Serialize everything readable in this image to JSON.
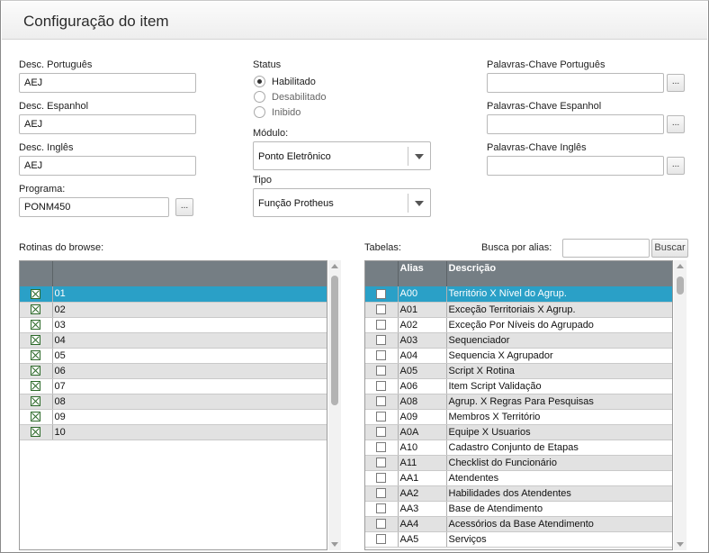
{
  "window": {
    "title": "Configuração do item"
  },
  "desc": {
    "portugues_label": "Desc. Português",
    "portugues_value": "AEJ",
    "espanhol_label": "Desc. Espanhol",
    "espanhol_value": "AEJ",
    "ingles_label": "Desc. Inglês",
    "ingles_value": "AEJ"
  },
  "programa": {
    "label": "Programa:",
    "value": "PONM450",
    "button_label": "..."
  },
  "status": {
    "label": "Status",
    "options": [
      "Habilitado",
      "Desabilitado",
      "Inibido"
    ],
    "selected": "Habilitado"
  },
  "modulo": {
    "label": "Módulo:",
    "value": "Ponto Eletrônico"
  },
  "tipo": {
    "label": "Tipo",
    "value": "Função Protheus"
  },
  "keywords": {
    "portugues_label": "Palavras-Chave Português",
    "portugues_value": "",
    "espanhol_label": "Palavras-Chave Espanhol",
    "espanhol_value": "",
    "ingles_label": "Palavras-Chave Inglês",
    "ingles_value": "",
    "button_label": "..."
  },
  "rotinas": {
    "label": "Rotinas do browse:",
    "rows": [
      {
        "value": "01",
        "checked": true
      },
      {
        "value": "02",
        "checked": true
      },
      {
        "value": "03",
        "checked": true
      },
      {
        "value": "04",
        "checked": true
      },
      {
        "value": "05",
        "checked": true
      },
      {
        "value": "06",
        "checked": true
      },
      {
        "value": "07",
        "checked": true
      },
      {
        "value": "08",
        "checked": true
      },
      {
        "value": "09",
        "checked": true
      },
      {
        "value": "10",
        "checked": true
      }
    ],
    "selected_index": 0
  },
  "tabelas": {
    "label": "Tabelas:",
    "search_label": "Busca por alias:",
    "search_value": "",
    "search_button": "Buscar",
    "columns": [
      "Alias",
      "Descrição"
    ],
    "rows": [
      {
        "alias": "A00",
        "descricao": "Território X Nível do Agrup.",
        "checked": false
      },
      {
        "alias": "A01",
        "descricao": "Exceção Territoriais X Agrup.",
        "checked": false
      },
      {
        "alias": "A02",
        "descricao": "Exceção Por Níveis do Agrupado",
        "checked": false
      },
      {
        "alias": "A03",
        "descricao": "Sequenciador",
        "checked": false
      },
      {
        "alias": "A04",
        "descricao": "Sequencia X Agrupador",
        "checked": false
      },
      {
        "alias": "A05",
        "descricao": "Script X Rotina",
        "checked": false
      },
      {
        "alias": "A06",
        "descricao": "Item Script Validação",
        "checked": false
      },
      {
        "alias": "A08",
        "descricao": "Agrup. X Regras Para Pesquisas",
        "checked": false
      },
      {
        "alias": "A09",
        "descricao": "Membros X Território",
        "checked": false
      },
      {
        "alias": "A0A",
        "descricao": "Equipe X Usuarios",
        "checked": false
      },
      {
        "alias": "A10",
        "descricao": "Cadastro Conjunto de Etapas",
        "checked": false
      },
      {
        "alias": "A11",
        "descricao": "Checklist do Funcionário",
        "checked": false
      },
      {
        "alias": "AA1",
        "descricao": "Atendentes",
        "checked": false
      },
      {
        "alias": "AA2",
        "descricao": "Habilidades dos Atendentes",
        "checked": false
      },
      {
        "alias": "AA3",
        "descricao": "Base de Atendimento",
        "checked": false
      },
      {
        "alias": "AA4",
        "descricao": "Acessórios da Base Atendimento",
        "checked": false
      },
      {
        "alias": "AA5",
        "descricao": "Serviços",
        "checked": false
      }
    ],
    "selected_index": 0
  },
  "colors": {
    "header_bg": "#757e84",
    "selection": "#2aa0c7",
    "alt_row": "#e2e2e2"
  }
}
